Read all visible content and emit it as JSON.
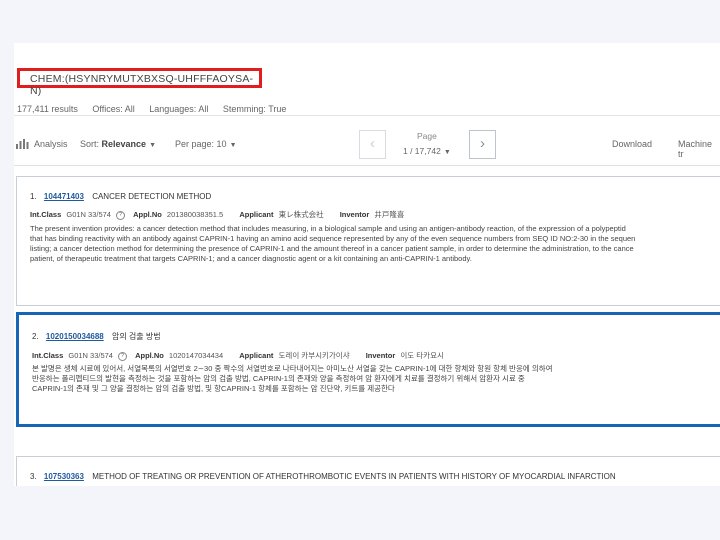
{
  "query": {
    "text": "CHEM:(HSYNRYMUTXBXSQ-UHFFFAOYSA-N)"
  },
  "filters": {
    "results": "177,411 results",
    "offices": "Offices: All",
    "languages": "Languages: All",
    "stemming": "Stemming: True"
  },
  "toolbar": {
    "analysis": "Analysis",
    "sort_label": "Sort:",
    "sort_value": "Relevance",
    "per_page_label": "Per page:",
    "per_page_value": "10",
    "page_label": "Page",
    "page_value": "1 / 17,742",
    "download": "Download",
    "machine": "Machine tr"
  },
  "results": [
    {
      "index": "1.",
      "pub_no": "104471403",
      "title": "CANCER DETECTION METHOD",
      "int_class_label": "Int.Class",
      "int_class": "G01N 33/574",
      "appl_label": "Appl.No",
      "appl_no": "201380038351.5",
      "applicant_label": "Applicant",
      "applicant": "東レ株式会社",
      "inventor_label": "Inventor",
      "inventor": "井戸隆喜",
      "abstract": [
        "The present invention provides: a cancer detection method that includes measuring, in a biological sample and using an antigen-antibody reaction, of the expression of a polypeptid",
        "that has binding reactivity with an antibody against CAPRIN-1 having an amino acid sequence represented by any of the even sequence numbers from SEQ ID NO:2-30 in the sequen",
        "listing; a cancer detection method for determining the presence of CAPRIN-1 and the amount thereof in a cancer patient sample, in order to determine the administration, to the cance",
        "patient, of therapeutic treatment that targets CAPRIN-1; and a cancer diagnostic agent or a kit containing an anti-CAPRIN-1 antibody."
      ]
    },
    {
      "index": "2.",
      "pub_no": "1020150034688",
      "title": "암의 검출 방법",
      "int_class_label": "Int.Class",
      "int_class": "G01N 33/574",
      "appl_label": "Appl.No",
      "appl_no": "1020147034434",
      "applicant_label": "Applicant",
      "applicant": "도레이 카부시키가이샤",
      "inventor_label": "Inventor",
      "inventor": "이도 타카요시",
      "abstract": [
        "본 발명은 생체 시료에 있어서, 서열목록의 서열번호 2∼30 중 짝수의 서열번호로 나타내어지는 아미노산 서열을 갖는 CAPRIN-1에 대한 항체와 항원 항체 반응에 의하여",
        "반응하는 폴리펩티드의 발현을 측정하는 것을 포함하는 암의 검출 방법, CAPRIN-1의 존재와 양을 측정하여 암 환자에게 치료를 결정하기 위해서 암환자 시료 중",
        "CAPRIN-1의 존재 및 그 양을 결정하는 암의 검출 방법, 및 항CAPRIN-1 항체를 포함하는 암 진단약, 키트를 제공한다"
      ]
    },
    {
      "index": "3.",
      "pub_no": "107530363",
      "title": "METHOD OF TREATING OR PREVENTION OF ATHEROTHROMBOTIC EVENTS IN PATIENTS WITH HISTORY OF MYOCARDIAL INFARCTION"
    }
  ]
}
